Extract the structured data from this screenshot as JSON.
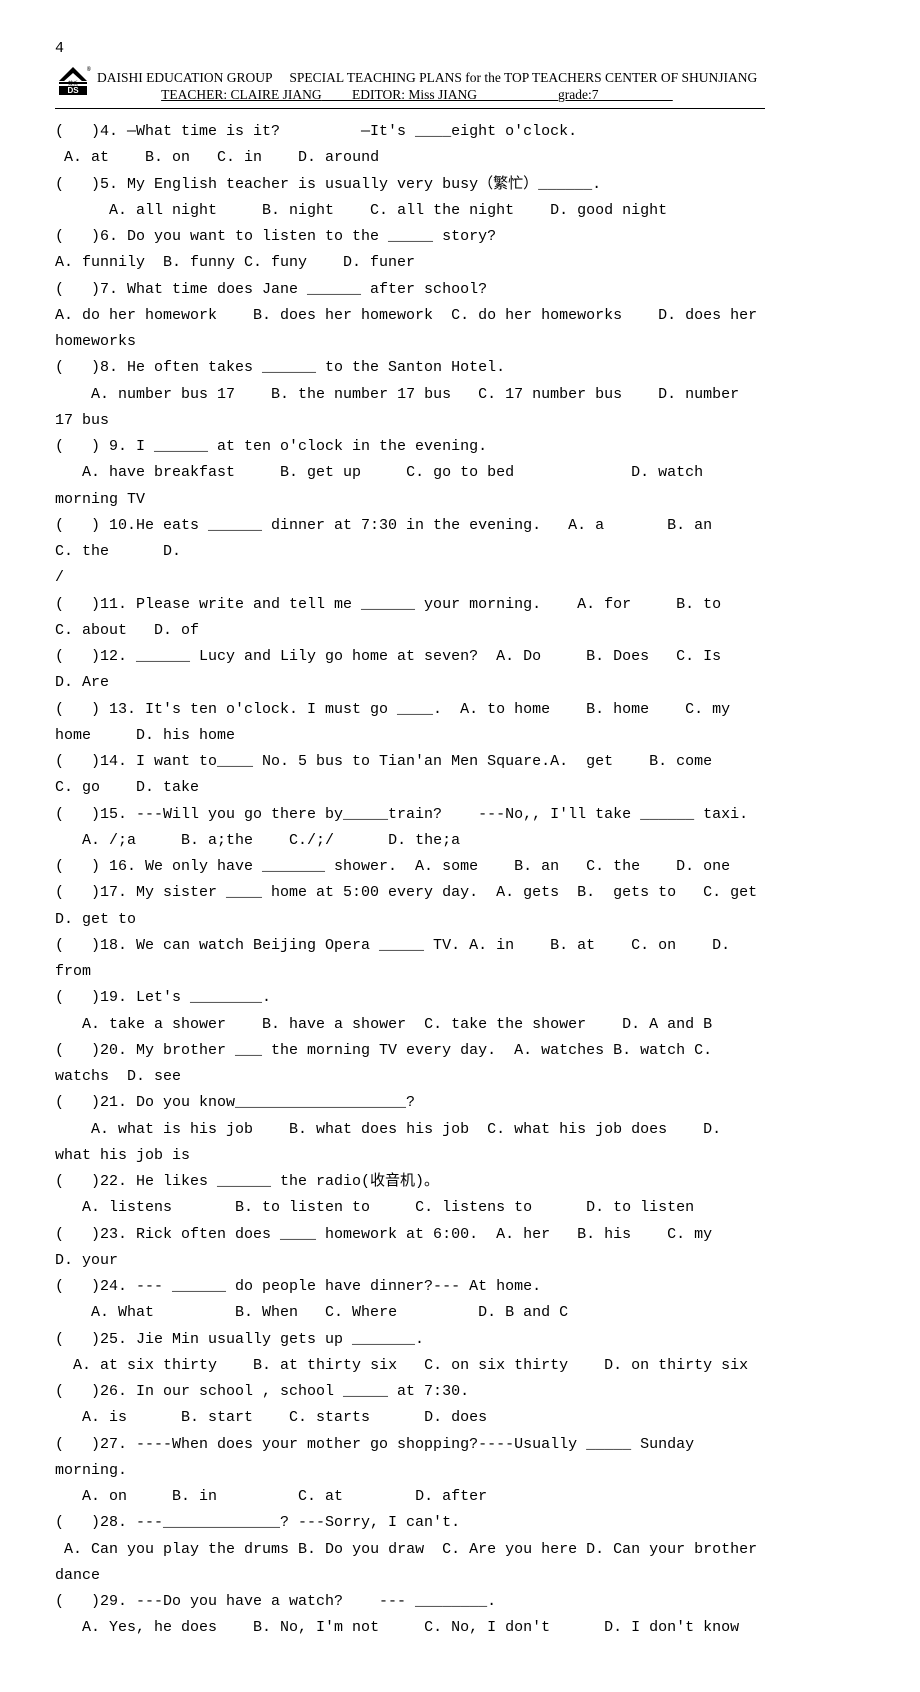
{
  "page_number_top": "4",
  "header": {
    "org": "DAISHI EDUCATION GROUP",
    "plans": "SPECIAL TEACHING PLANS for the TOP TEACHERS CENTER OF SHUNJIANG",
    "teacher_label": "TEACHER: CLAIRE JIANG",
    "editor_label": "EDITOR: Miss JIANG",
    "grade_label": "grade:7"
  },
  "lines": [
    "(   )4. —What time is it?         —It's ____eight o'clock.",
    " A. at    B. on   C. in    D. around",
    "(   )5. My English teacher is usually very busy（繁忙）______.",
    "      A. all night     B. night    C. all the night    D. good night",
    "(   )6. Do you want to listen to the _____ story?",
    "A. funnily  B. funny C. funy    D. funer",
    "(   )7. What time does Jane ______ after school?",
    "A. do her homework    B. does her homework  C. do her homeworks    D. does her homeworks",
    "(   )8. He often takes ______ to the Santon Hotel.",
    "    A. number bus 17    B. the number 17 bus   C. 17 number bus    D. number 17 bus",
    "(   ) 9. I ______ at ten o'clock in the evening.",
    "   A. have breakfast     B. get up     C. go to bed             D. watch morning TV",
    "(   ) 10.He eats ______ dinner at 7:30 in the evening.   A. a       B. an     C. the      D.",
    "/",
    "(   )11. Please write and tell me ______ your morning.    A. for     B. to     C. about   D. of",
    "(   )12. ______ Lucy and Lily go home at seven?  A. Do     B. Does   C. Is       D. Are",
    "(   ) 13. It's ten o'clock. I must go ____.  A. to home    B. home    C. my home     D. his home",
    "(   )14. I want to____ No. 5 bus to Tian'an Men Square.A.  get    B. come    C. go    D. take",
    "(   )15. ---Will you go there by_____train?    ---No,, I'll take ______ taxi.",
    "   A. /;a     B. a;the    C./;/      D. the;a",
    "(   ) 16. We only have _______ shower.  A. some    B. an   C. the    D. one",
    "(   )17. My sister ____ home at 5:00 every day.  A. gets  B.  gets to   C. get   D. get to",
    "(   )18. We can watch Beijing Opera _____ TV. A. in    B. at    C. on    D. from",
    "(   )19. Let's ________.",
    "   A. take a shower    B. have a shower  C. take the shower    D. A and B",
    "(   )20. My brother ___ the morning TV every day.  A. watches B. watch C. watchs  D. see",
    "(   )21. Do you know___________________?",
    "    A. what is his job    B. what does his job  C. what his job does    D. what his job is",
    "(   )22. He likes ______ the radio(收音机)。",
    "   A. listens       B. to listen to     C. listens to      D. to listen",
    "(   )23. Rick often does ____ homework at 6:00.  A. her   B. his    C. my    D. your",
    "(   )24. --- ______ do people have dinner?--- At home.",
    "    A. What         B. When   C. Where         D. B and C",
    "(   )25. Jie Min usually gets up _______.",
    "  A. at six thirty    B. at thirty six   C. on six thirty    D. on thirty six",
    "(   )26. In our school , school _____ at 7:30.",
    "   A. is      B. start    C. starts      D. does",
    "(   )27. ----When does your mother go shopping?----Usually _____ Sunday morning.",
    "   A. on     B. in         C. at        D. after",
    "(   )28. ---_____________? ---Sorry, I can't.",
    " A. Can you play the drums B. Do you draw  C. Are you here D. Can your brother dance",
    "(   )29. ---Do you have a watch?    --- ________.",
    "   A. Yes, he does    B. No, I'm not     C. No, I don't      D. I don't know"
  ]
}
